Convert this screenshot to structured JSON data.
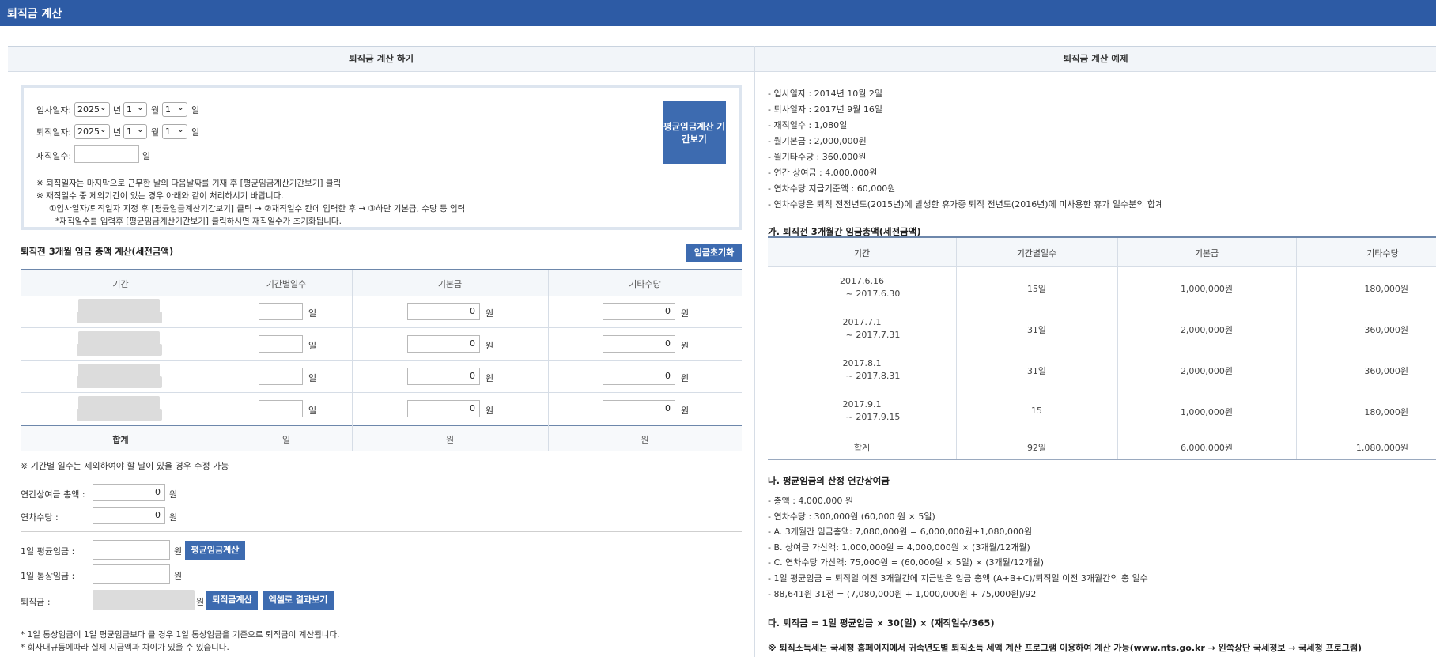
{
  "app": {
    "title": "퇴직금 계산"
  },
  "left": {
    "header": "퇴직금 계산 하기",
    "start_label": "입사일자:",
    "end_label": "퇴직일자:",
    "days_label": "재직일수:",
    "year_value": "2025",
    "month_value": "1",
    "day_value": "1",
    "unit_year": "년",
    "unit_month": "월",
    "unit_day": "일",
    "period_button": "평균임금계산 기간보기",
    "notes": [
      "※ 퇴직일자는 마지막으로 근무한 날의 다음날짜를 기재 후 [평균임금계산기간보기] 클릭",
      "※ 재직일수 중 제외기간이 있는 경우 아래와 같이 처리하시기 바랍니다.",
      "①입사일자/퇴직일자 지정 후 [평균임금계산기간보기] 클릭 → ②재직일수 칸에 입력한 후 → ③하단 기본급, 수당 등 입력",
      "*재직일수를 입력후 [평균임금계산기간보기] 클릭하시면 재직일수가 초기화됩니다."
    ],
    "section_title": "퇴직전 3개월 임금 총액 계산(세전금액)",
    "reset_button": "임금초기화",
    "table": {
      "headers": [
        "기간",
        "기간별일수",
        "기본급",
        "기타수당"
      ],
      "rows": [
        {
          "days": "",
          "base": "0",
          "other": "0"
        },
        {
          "days": "",
          "base": "0",
          "other": "0"
        },
        {
          "days": "",
          "base": "0",
          "other": "0"
        },
        {
          "days": "",
          "base": "0",
          "other": "0"
        }
      ],
      "unit_day": "일",
      "unit_won": "원",
      "total_label": "합계",
      "total_days_unit": "일",
      "total_base_unit": "원",
      "total_other_unit": "원"
    },
    "table_note": "※ 기간별 일수는 제외하여야 할 날이 있을 경우 수정 가능",
    "annual_bonus_label": "연간상여금 총액 :",
    "annual_bonus_value": "0",
    "annual_leave_label": "연차수당 :",
    "annual_leave_value": "0",
    "won": "원",
    "avg_wage_label": "1일 평균임금 :",
    "avg_wage_button": "평균임금계산",
    "ordinary_wage_label": "1일 통상임금 :",
    "severance_label": "퇴직금 :",
    "severance_button": "퇴직금계산",
    "excel_button": "엑셀로 결과보기",
    "footnotes": [
      "* 1일 통상임금이 1일 평균임금보다 클 경우 1일 통상임금을 기준으로 퇴직금이 계산됩니다.",
      "* 회사내규등에따라 실제 지급액과 차이가 있을 수 있습니다."
    ]
  },
  "right": {
    "header": "퇴직금 계산 예제",
    "info": [
      "- 입사일자 : 2014년 10월 2일",
      "- 퇴사일자 : 2017년 9월 16일",
      "- 재직일수 : 1,080일",
      "- 월기본급 : 2,000,000원",
      "- 월기타수당 : 360,000원",
      "- 연간 상여금 : 4,000,000원",
      "- 연차수당 지급기준액 : 60,000원",
      "- 연차수당은 퇴직 전전년도(2015년)에 발생한 휴가중 퇴직 전년도(2016년)에 미사용한 휴가 일수분의 합계"
    ],
    "section_a": "가. 퇴직전 3개월간 임금총액(세전금액)",
    "table": {
      "headers": [
        "기간",
        "기간별일수",
        "기본급",
        "기타수당"
      ],
      "rows": [
        {
          "period1": "2017.6.16",
          "period2": "~ 2017.6.30",
          "days": "15일",
          "base": "1,000,000원",
          "other": "180,000원"
        },
        {
          "period1": "2017.7.1",
          "period2": "~ 2017.7.31",
          "days": "31일",
          "base": "2,000,000원",
          "other": "360,000원"
        },
        {
          "period1": "2017.8.1",
          "period2": "~ 2017.8.31",
          "days": "31일",
          "base": "2,000,000원",
          "other": "360,000원"
        },
        {
          "period1": "2017.9.1",
          "period2": "~ 2017.9.15",
          "days": "15",
          "base": "1,000,000원",
          "other": "180,000원"
        }
      ],
      "total": {
        "label": "합계",
        "days": "92일",
        "base": "6,000,000원",
        "other": "1,080,000원"
      }
    },
    "section_b": "나. 평균임금의 산정 연간상여금",
    "calc_lines": [
      "- 총액 : 4,000,000 원",
      "- 연차수당 : 300,000원 (60,000 원 × 5일)",
      "- A. 3개월간 임금총액: 7,080,000원 = 6,000,000원+1,080,000원",
      "- B. 상여금 가산액: 1,000,000원 = 4,000,000원 × (3개월/12개월)",
      "- C. 연차수당 가산액: 75,000원 = (60,000원 × 5일) × (3개월/12개월)",
      "- 1일 평균임금 = 퇴직일 이전 3개월간에 지급받은 임금 총액 (A+B+C)/퇴직일 이전 3개월간의 총 일수",
      "- 88,641원 31전 = (7,080,000원 + 1,000,000원 + 75,000원)/92"
    ],
    "section_c": "다. 퇴직금 = 1일 평균임금 × 30(일) × (재직일수/365)",
    "tax_note": "※ 퇴직소득세는 국세청 홈페이지에서 귀속년도별 퇴직소득 세액 계산 프로그램 이용하여 계산 가능(www.nts.go.kr → 왼쪽상단 국세정보 → 국세청 프로그램)"
  }
}
